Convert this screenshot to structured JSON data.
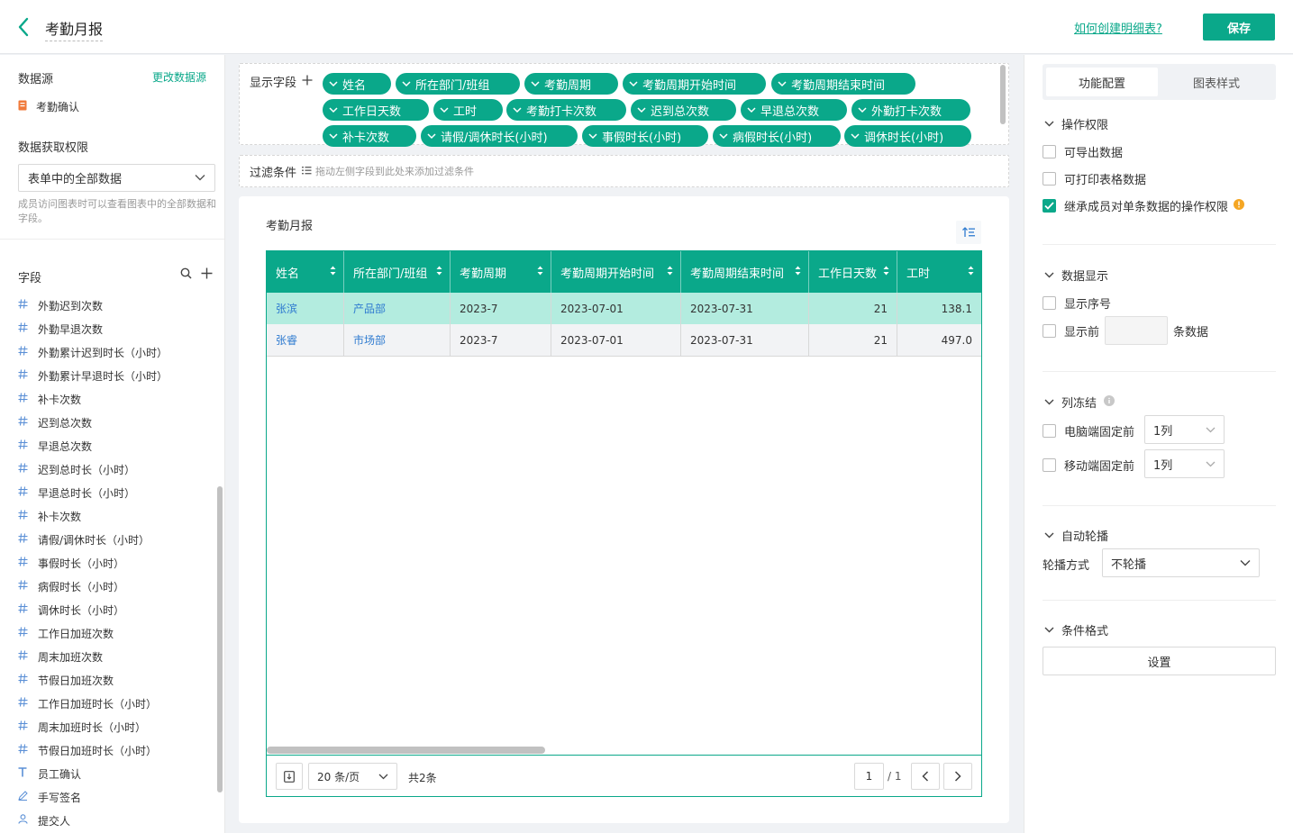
{
  "header": {
    "title": "考勤月报",
    "help_link": "如何创建明细表?",
    "save_label": "保存"
  },
  "left": {
    "datasource_title": "数据源",
    "change_datasource": "更改数据源",
    "datasource_item": "考勤确认",
    "permission_title": "数据获取权限",
    "permission_value": "表单中的全部数据",
    "permission_hint": "成员访问图表时可以查看图表中的全部数据和字段。",
    "fields_title": "字段",
    "fields": [
      {
        "icon": "number-icon",
        "label": "外勤迟到次数"
      },
      {
        "icon": "number-icon",
        "label": "外勤早退次数"
      },
      {
        "icon": "number-icon",
        "label": "外勤累计迟到时长（小时）"
      },
      {
        "icon": "number-icon",
        "label": "外勤累计早退时长（小时）"
      },
      {
        "icon": "number-icon",
        "label": "补卡次数"
      },
      {
        "icon": "number-icon",
        "label": "迟到总次数"
      },
      {
        "icon": "number-icon",
        "label": "早退总次数"
      },
      {
        "icon": "number-icon",
        "label": "迟到总时长（小时）"
      },
      {
        "icon": "number-icon",
        "label": "早退总时长（小时）"
      },
      {
        "icon": "number-icon",
        "label": "补卡次数"
      },
      {
        "icon": "number-icon",
        "label": "请假/调休时长（小时）"
      },
      {
        "icon": "number-icon",
        "label": "事假时长（小时）"
      },
      {
        "icon": "number-icon",
        "label": "病假时长（小时）"
      },
      {
        "icon": "number-icon",
        "label": "调休时长（小时）"
      },
      {
        "icon": "number-icon",
        "label": "工作日加班次数"
      },
      {
        "icon": "number-icon",
        "label": "周末加班次数"
      },
      {
        "icon": "number-icon",
        "label": "节假日加班次数"
      },
      {
        "icon": "number-icon",
        "label": "工作日加班时长（小时）"
      },
      {
        "icon": "number-icon",
        "label": "周末加班时长（小时）"
      },
      {
        "icon": "number-icon",
        "label": "节假日加班时长（小时）"
      },
      {
        "icon": "text-icon",
        "label": "员工确认"
      },
      {
        "icon": "signature-icon",
        "label": "手写签名"
      },
      {
        "icon": "user-icon",
        "label": "提交人"
      }
    ]
  },
  "display_fields": {
    "label": "显示字段",
    "tags": [
      "姓名",
      "所在部门/班组",
      "考勤周期",
      "考勤周期开始时间",
      "考勤周期结束时间",
      "工作日天数",
      "工时",
      "考勤打卡次数",
      "迟到总次数",
      "早退总次数",
      "外勤打卡次数",
      "补卡次数",
      "请假/调休时长(小时)",
      "事假时长(小时)",
      "病假时长(小时)",
      "调休时长(小时)"
    ]
  },
  "filter": {
    "label": "过滤条件",
    "hint": "拖动左侧字段到此处来添加过滤条件"
  },
  "table": {
    "title": "考勤月报",
    "columns": [
      "姓名",
      "所在部门/班组",
      "考勤周期",
      "考勤周期开始时间",
      "考勤周期结束时间",
      "工作日天数",
      "工时"
    ],
    "rows": [
      [
        "张滨",
        "产品部",
        "2023-7",
        "2023-07-01",
        "2023-07-31",
        "21",
        "138.1"
      ],
      [
        "张睿",
        "市场部",
        "2023-7",
        "2023-07-01",
        "2023-07-31",
        "21",
        "497.0"
      ]
    ],
    "page_size": "20 条/页",
    "total": "共2条",
    "page": "1",
    "page_total": "/ 1"
  },
  "right": {
    "tab_config": "功能配置",
    "tab_style": "图表样式",
    "ops_title": "操作权限",
    "ops": [
      {
        "label": "可导出数据",
        "checked": false
      },
      {
        "label": "可打印表格数据",
        "checked": false
      },
      {
        "label": "继承成员对单条数据的操作权限",
        "checked": true
      }
    ],
    "display_title": "数据显示",
    "show_index": "显示序号",
    "show_first": "显示前",
    "show_first_suffix": "条数据",
    "freeze_title": "列冻结",
    "freeze_pc": "电脑端固定前",
    "freeze_pc_value": "1列",
    "freeze_mobile": "移动端固定前",
    "freeze_mobile_value": "1列",
    "carousel_title": "自动轮播",
    "carousel_label": "轮播方式",
    "carousel_value": "不轮播",
    "cond_title": "条件格式",
    "cond_button": "设置"
  },
  "colors": {
    "accent": "#0aa88a",
    "row_highlight": "#b3ecdf",
    "row_alt": "#f2f3f5",
    "link": "#2f7bd0",
    "warning": "#f5a623"
  }
}
